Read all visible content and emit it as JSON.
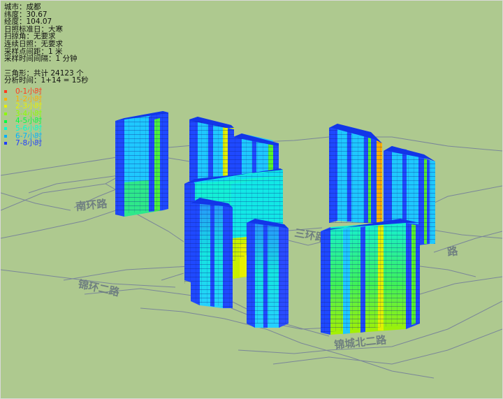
{
  "info": {
    "city": "城市：成都",
    "latitude": "纬度：30.67",
    "longitude": "经度：104.07",
    "standard_day": "日照标准日：大寒",
    "sweep_angle": "扫掠角：无要求",
    "continuous": "连续日照：无要求",
    "sample_spacing": "采样点间距：1 米",
    "sample_interval": "采样时间间隔：1 分钟",
    "triangles": "三角形：共计 24123 个",
    "analysis_time": "分析时间：1+14 = 15秒"
  },
  "legend": [
    {
      "label": "0-1小时",
      "color": "#ff3b1f"
    },
    {
      "label": "1-2小时",
      "color": "#ffb000"
    },
    {
      "label": "2-3小时",
      "color": "#e8f000"
    },
    {
      "label": "3-4小时",
      "color": "#8cff00"
    },
    {
      "label": "4-5小时",
      "color": "#00ff40"
    },
    {
      "label": "5-6小时",
      "color": "#00ffd0"
    },
    {
      "label": "6-7小时",
      "color": "#00b0ff"
    },
    {
      "label": "7-8小时",
      "color": "#1e3cff"
    }
  ],
  "roads": {
    "top_left": "南环路",
    "middle": "三环路",
    "left_bottom": "锦环二路",
    "bottom": "锦城北二路",
    "right": "路"
  },
  "colors": {
    "background": "#aec98f",
    "road_line": "#7a8699",
    "wall_blue": "#1f49ff",
    "wall_cyan": "#12f0e6",
    "wall_green": "#59f52a",
    "wall_yellow": "#d6f000",
    "wall_sky": "#20b8ff"
  }
}
